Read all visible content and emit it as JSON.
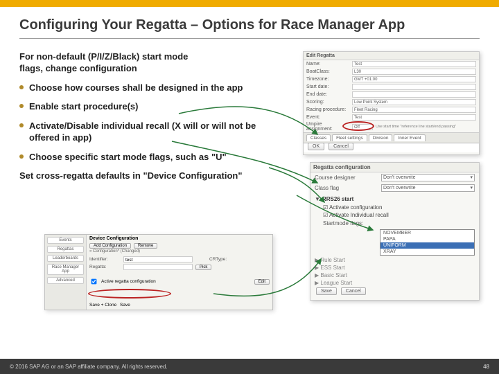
{
  "title": "Configuring Your Regatta – Options for Race Manager App",
  "lead": "For non-default (P/I/Z/Black) start mode flags, change configuration",
  "bullets": [
    "Choose how courses shall be designed in the app",
    "Enable start procedure(s)",
    "Activate/Disable individual recall (X will or will not be offered in app)",
    "Choose specific start mode flags, such as \"U\""
  ],
  "subtext": "Set cross-regatta defaults in \"Device Configuration\"",
  "edit_dialog": {
    "title": "Edit Regatta",
    "fields": {
      "name_lbl": "Name:",
      "name_val": "Test",
      "boatclass_lbl": "BoatClass:",
      "boatclass_val": "L30",
      "timezone_lbl": "Timezone:",
      "timezone_val": "GMT +01:00",
      "startdate_lbl": "Start date:",
      "enddate_lbl": "End date:",
      "scoring_lbl": "Scoring:",
      "scoring_val": "Low Point System",
      "racing_lbl": "Racing procedure:",
      "racing_val": "Fleet Racing",
      "event_lbl": "Event:",
      "event_val": "Test",
      "umpire_lbl": "Umpire assignment:",
      "umpire_val": "Off",
      "umpire_note": "Use start time \"reference line start/end passing\""
    },
    "tabs": [
      "Classes",
      "Fleet settings",
      "Division",
      "Inner Event"
    ],
    "ok": "OK",
    "cancel": "Cancel"
  },
  "config_panel": {
    "title": "Regatta configuration",
    "course_lbl": "Course designer",
    "course_val": "Don't overwrite",
    "class_lbl": "Class flag",
    "class_val": "Don't overwrite",
    "section_open": "RRS26 start",
    "chk1": "Activate configuration",
    "chk2": "Activate Individual recall",
    "startmode_lbl": "Startmode flags:",
    "options": [
      "NOVEMBER",
      "PAPA",
      "UNIFORM",
      "XRAY"
    ],
    "sections_closed": [
      "Rule Start",
      "ESS Start",
      "Basic Start",
      "League Start"
    ],
    "save": "Save",
    "cancel": "Cancel"
  },
  "device_panel": {
    "sidebar": [
      "Events",
      "Regattas",
      "Leaderboards",
      "Race Manager App",
      "Advanced"
    ],
    "heading": "Device Configuration",
    "tabs": [
      "Add Configuration",
      "Remove"
    ],
    "crumb": "« Configuration* (Changed)",
    "identifier_lbl": "Identifier:",
    "identifier_val": "test",
    "crtype_lbl": "CRType:",
    "crtype_val": "",
    "pick_btn": "Pick",
    "regatta_lbl": "Regatta:",
    "regatta_val": "",
    "edit_btn": "Edit",
    "active_lbl": "Active regatta configuration",
    "active_edit": "Edit",
    "save_clone": "Save + Clone",
    "save": "Save"
  },
  "footer": {
    "copyright": "© 2016 SAP AG or an SAP affiliate company. All rights reserved.",
    "page": "48"
  }
}
